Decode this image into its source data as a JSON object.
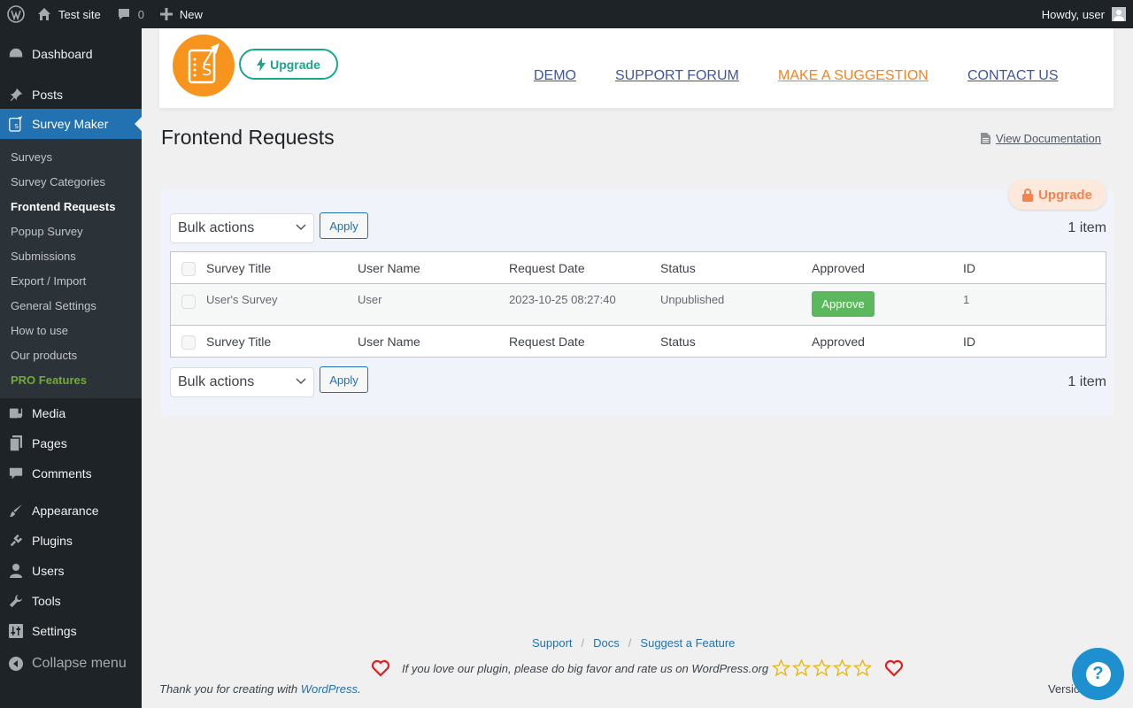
{
  "adminbar": {
    "site_name": "Test site",
    "comments_count": "0",
    "new_label": "New",
    "howdy": "Howdy, user"
  },
  "sidebar": {
    "dashboard": "Dashboard",
    "posts": "Posts",
    "survey_maker": "Survey Maker",
    "submenu": [
      "Surveys",
      "Survey Categories",
      "Frontend Requests",
      "Popup Survey",
      "Submissions",
      "Export / Import",
      "General Settings",
      "How to use",
      "Our products",
      "PRO Features"
    ],
    "media": "Media",
    "pages": "Pages",
    "comments": "Comments",
    "appearance": "Appearance",
    "plugins": "Plugins",
    "users": "Users",
    "tools": "Tools",
    "settings": "Settings",
    "collapse": "Collapse menu"
  },
  "plugin_header": {
    "upgrade_label": "Upgrade",
    "links": [
      "DEMO",
      "SUPPORT FORUM",
      "MAKE A SUGGESTION",
      "CONTACT US"
    ]
  },
  "page": {
    "title": "Frontend Requests",
    "doc_link": "View Documentation",
    "pro_upgrade": "Upgrade"
  },
  "table": {
    "bulk_actions": "Bulk actions",
    "apply_label": "Apply",
    "items_count": "1 item",
    "columns": [
      "Survey Title",
      "User Name",
      "Request Date",
      "Status",
      "Approved",
      "ID"
    ],
    "rows": [
      {
        "survey_title": "User's Survey",
        "user_name": "User",
        "request_date": "2023-10-25 08:27:40",
        "status": "Unpublished",
        "approve_label": "Approve",
        "id": "1"
      }
    ]
  },
  "footer": {
    "links": [
      "Support",
      "Docs",
      "Suggest a Feature"
    ],
    "rate_text": "If you love our plugin, please do big favor and rate us on WordPress.org",
    "thanks_prefix": "Thank you for creating with ",
    "thanks_link": "WordPress",
    "thanks_suffix": ".",
    "version": "Versio",
    "help": "?"
  },
  "colors": {
    "admin_dark": "#1d2327",
    "accent_blue": "#2271b1",
    "logo_orange": "#f7941d",
    "upgrade_teal": "#1aa58d",
    "suggest_orange": "#f58220",
    "pro_green": "#72aa36",
    "approve_green": "#5cb85c",
    "heart_red": "#e0201d"
  },
  "icons": {
    "wp_logo": "wordpress-icon",
    "home": "home-icon",
    "comment": "comment-bubble-icon",
    "plus": "plus-icon",
    "bolt": "lightning-icon",
    "lock": "lock-icon",
    "doc": "document-icon",
    "heart": "heart-icon",
    "star": "star-outline-icon",
    "help": "help-question-icon"
  }
}
